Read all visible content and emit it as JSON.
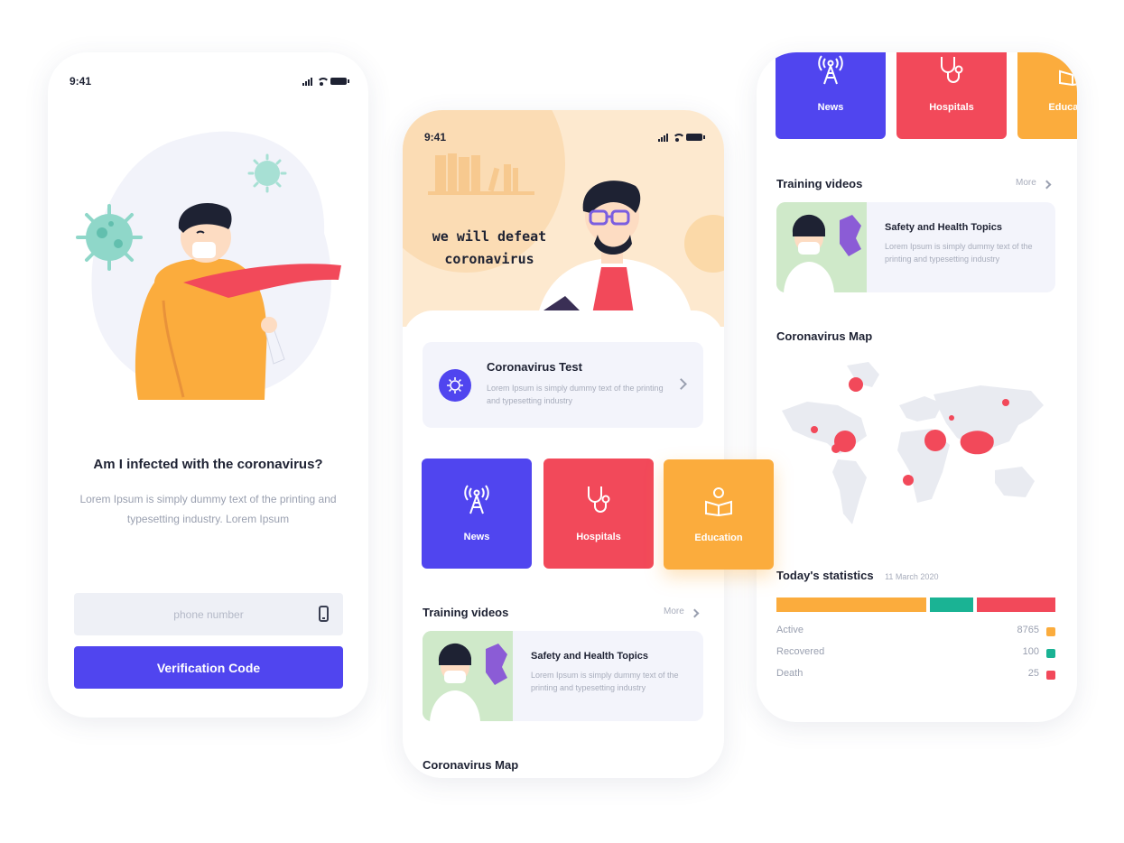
{
  "colors": {
    "primary": "#5045ef",
    "red": "#f2495a",
    "orange": "#fbac3d",
    "teal": "#1ab394",
    "cream": "#fde9cf"
  },
  "status": {
    "time": "9:41"
  },
  "login": {
    "title": "Am I infected with the coronavirus?",
    "description": "Lorem Ipsum is simply dummy text of the printing and typesetting industry. Lorem Ipsum",
    "phone_placeholder": "phone number",
    "phone_value": "",
    "verify_label": "Verification Code"
  },
  "home": {
    "hero_line1": "we will defeat",
    "hero_line2": "coronavirus",
    "test_card": {
      "title": "Coronavirus Test",
      "description": "Lorem Ipsum is simply dummy text of the printing and typesetting industry"
    },
    "tiles": [
      {
        "label": "News",
        "icon": "antenna-icon"
      },
      {
        "label": "Hospitals",
        "icon": "stethoscope-icon"
      },
      {
        "label": "Education",
        "icon": "reader-icon"
      }
    ],
    "training": {
      "title": "Training videos",
      "more": "More",
      "video": {
        "title": "Safety and Health Topics",
        "description": "Lorem Ipsum is simply dummy text of the printing and typesetting industry"
      }
    },
    "map_title": "Coronavirus Map"
  },
  "stats": {
    "title": "Today's statistics",
    "date": "11 March 2020",
    "rows": [
      {
        "label": "Active",
        "value": "8765",
        "color": "#fbac3d"
      },
      {
        "label": "Recovered",
        "value": "100",
        "color": "#1ab394"
      },
      {
        "label": "Death",
        "value": "25",
        "color": "#f2495a"
      }
    ],
    "bar_shares": [
      0.55,
      0.16,
      0.29
    ]
  }
}
